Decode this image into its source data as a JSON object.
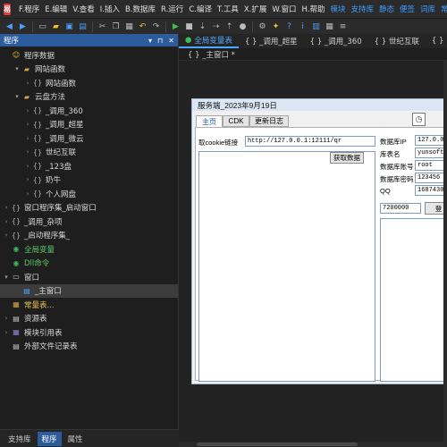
{
  "menu": {
    "items": [
      {
        "label": "F.程序",
        "accent": false
      },
      {
        "label": "E.编辑",
        "accent": false
      },
      {
        "label": "V.查看",
        "accent": false
      },
      {
        "label": "I.插入",
        "accent": false
      },
      {
        "label": "B.数据库",
        "accent": false
      },
      {
        "label": "R.运行",
        "accent": false
      },
      {
        "label": "C.编译",
        "accent": false
      },
      {
        "label": "T.工具",
        "accent": false
      },
      {
        "label": "X.扩展",
        "accent": false
      },
      {
        "label": "W.窗口",
        "accent": false
      },
      {
        "label": "H.帮助",
        "accent": false
      },
      {
        "label": "模块",
        "accent": true
      },
      {
        "label": "支持库",
        "accent": true
      },
      {
        "label": "静态",
        "accent": true
      },
      {
        "label": "便签",
        "accent": true
      },
      {
        "label": "词库",
        "accent": true
      },
      {
        "label": "常",
        "accent": true
      }
    ]
  },
  "toolbar": {
    "icons": [
      {
        "name": "back-icon",
        "glyph": "◀",
        "color": "blue"
      },
      {
        "name": "forward-icon",
        "glyph": "▶",
        "color": "blue"
      },
      {
        "name": "new-file-icon",
        "glyph": "▭",
        "color": ""
      },
      {
        "name": "open-folder-icon",
        "glyph": "▰",
        "color": "yellow"
      },
      {
        "name": "save-icon",
        "glyph": "▣",
        "color": "blue"
      },
      {
        "name": "save-all-icon",
        "glyph": "▤",
        "color": "blue"
      },
      {
        "name": "cut-icon",
        "glyph": "✂",
        "color": ""
      },
      {
        "name": "copy-icon",
        "glyph": "❐",
        "color": ""
      },
      {
        "name": "paste-icon",
        "glyph": "▦",
        "color": ""
      },
      {
        "name": "undo-icon",
        "glyph": "↶",
        "color": "yellow"
      },
      {
        "name": "redo-icon",
        "glyph": "↷",
        "color": ""
      },
      {
        "name": "run-icon",
        "glyph": "▶",
        "color": "green"
      },
      {
        "name": "stop-icon",
        "glyph": "■",
        "color": ""
      },
      {
        "name": "step-into-icon",
        "glyph": "⇣",
        "color": ""
      },
      {
        "name": "step-over-icon",
        "glyph": "⇢",
        "color": ""
      },
      {
        "name": "step-out-icon",
        "glyph": "⇡",
        "color": ""
      },
      {
        "name": "breakpoint-icon",
        "glyph": "●",
        "color": ""
      },
      {
        "name": "compile-icon",
        "glyph": "⚙",
        "color": ""
      },
      {
        "name": "lightbulb-icon",
        "glyph": "✦",
        "color": "yellow"
      },
      {
        "name": "help-icon",
        "glyph": "?",
        "color": "blue"
      },
      {
        "name": "info-icon",
        "glyph": "i",
        "color": "blue"
      },
      {
        "name": "chart-icon",
        "glyph": "▥",
        "color": "blue"
      },
      {
        "name": "grid-icon",
        "glyph": "▦",
        "color": ""
      },
      {
        "name": "list-icon",
        "glyph": "≡",
        "color": ""
      }
    ]
  },
  "left_panel": {
    "title": "程序",
    "controls": [
      "▾",
      "⊓",
      "✕"
    ],
    "tree": [
      {
        "label": "程序数据",
        "depth": 0,
        "arrow": "",
        "icon": "☺",
        "icon_name": "smile-icon",
        "icon_class": "smile",
        "style": "",
        "selected": false
      },
      {
        "label": "网站函数",
        "depth": 1,
        "arrow": "▾",
        "icon": "▰",
        "icon_name": "folder-icon",
        "icon_class": "folder",
        "style": "",
        "selected": false
      },
      {
        "label": "网站函数",
        "depth": 2,
        "arrow": "›",
        "icon": "{}",
        "icon_name": "code-module-icon",
        "icon_class": "code",
        "style": "",
        "selected": false
      },
      {
        "label": "云盘方法",
        "depth": 1,
        "arrow": "▾",
        "icon": "▰",
        "icon_name": "folder-icon",
        "icon_class": "folder",
        "style": "",
        "selected": false
      },
      {
        "label": "_调用_360",
        "depth": 2,
        "arrow": "›",
        "icon": "{}",
        "icon_name": "code-module-icon",
        "icon_class": "code",
        "style": "",
        "selected": false
      },
      {
        "label": "_调用_超星",
        "depth": 2,
        "arrow": "›",
        "icon": "{}",
        "icon_name": "code-module-icon",
        "icon_class": "code",
        "style": "",
        "selected": false
      },
      {
        "label": "_调用_微云",
        "depth": 2,
        "arrow": "›",
        "icon": "{}",
        "icon_name": "code-module-icon",
        "icon_class": "code",
        "style": "",
        "selected": false
      },
      {
        "label": "世纪互联",
        "depth": 2,
        "arrow": "›",
        "icon": "{}",
        "icon_name": "code-module-icon",
        "icon_class": "code",
        "style": "",
        "selected": false
      },
      {
        "label": "_123盘",
        "depth": 2,
        "arrow": "›",
        "icon": "{}",
        "icon_name": "code-module-icon",
        "icon_class": "code",
        "style": "",
        "selected": false
      },
      {
        "label": "奶牛",
        "depth": 2,
        "arrow": "›",
        "icon": "{}",
        "icon_name": "code-module-icon",
        "icon_class": "code",
        "style": "",
        "selected": false
      },
      {
        "label": "个人网盘",
        "depth": 2,
        "arrow": "›",
        "icon": "{}",
        "icon_name": "code-module-icon",
        "icon_class": "code",
        "style": "",
        "selected": false
      },
      {
        "label": "窗口程序集_启动窗口",
        "depth": 0,
        "arrow": "›",
        "icon": "{}",
        "icon_name": "code-module-icon",
        "icon_class": "code",
        "style": "",
        "selected": false
      },
      {
        "label": "_调用_杂项",
        "depth": 0,
        "arrow": "›",
        "icon": "{}",
        "icon_name": "code-module-icon",
        "icon_class": "code",
        "style": "",
        "selected": false
      },
      {
        "label": "_启动程序集_",
        "depth": 0,
        "arrow": "›",
        "icon": "{}",
        "icon_name": "code-module-icon",
        "icon_class": "code",
        "style": "",
        "selected": false
      },
      {
        "label": "全局变量",
        "depth": 0,
        "arrow": "",
        "icon": "◉",
        "icon_name": "global-variable-icon",
        "icon_class": "green",
        "style": "greentext",
        "selected": false
      },
      {
        "label": "Dll命令",
        "depth": 0,
        "arrow": "",
        "icon": "◉",
        "icon_name": "dll-command-icon",
        "icon_class": "green",
        "style": "greentext",
        "selected": false
      },
      {
        "label": "窗口",
        "depth": 0,
        "arrow": "▾",
        "icon": "▭",
        "icon_name": "window-icon",
        "icon_class": "win",
        "style": "",
        "selected": false
      },
      {
        "label": "_主窗口",
        "depth": 1,
        "arrow": "",
        "icon": "▤",
        "icon_name": "form-icon",
        "icon_class": "db",
        "style": "",
        "selected": true
      },
      {
        "label": "常量表...",
        "depth": 0,
        "arrow": "",
        "icon": "▦",
        "icon_name": "constant-table-icon",
        "icon_class": "folder",
        "style": "yellowtext",
        "selected": false
      },
      {
        "label": "资源表",
        "depth": 0,
        "arrow": "›",
        "icon": "▤",
        "icon_name": "resource-table-icon",
        "icon_class": "win",
        "style": "",
        "selected": false
      },
      {
        "label": "模块引用表",
        "depth": 0,
        "arrow": "›",
        "icon": "▦",
        "icon_name": "module-reference-icon",
        "icon_class": "grid",
        "style": "",
        "selected": false
      },
      {
        "label": "外部文件记录表",
        "depth": 0,
        "arrow": "",
        "icon": "▤",
        "icon_name": "external-file-icon",
        "icon_class": "win",
        "style": "",
        "selected": false
      }
    ]
  },
  "bottom_tabs": [
    {
      "label": "支持库",
      "active": false
    },
    {
      "label": "程序",
      "active": true
    },
    {
      "label": "属性",
      "active": false
    }
  ],
  "editor": {
    "tabs": [
      {
        "label": "全局变量表",
        "active": true,
        "dot": "●"
      },
      {
        "label": "{ } _调用_超星",
        "active": false,
        "dot": ""
      },
      {
        "label": "{ } _调用_360",
        "active": false,
        "dot": ""
      },
      {
        "label": "{ } 世纪互联",
        "active": false,
        "dot": ""
      },
      {
        "label": "{ }",
        "active": false,
        "dot": ""
      }
    ],
    "sub_tab": "{ } _主窗口 *"
  },
  "form": {
    "title": "服务端_2023年9月19日",
    "tabs": [
      "主页",
      "CDK",
      "更新日志"
    ],
    "cookie_label": "取cookie链接",
    "cookie_url": "http://127.0.0.1:12111/qr",
    "fetch_button": "获取数据",
    "db_ip_label": "数据库IP",
    "db_ip_value": "127.0.0.1",
    "db_name_label": "库表名",
    "db_name_value": "yunsoft1",
    "db_user_label": "数据库账号",
    "db_user_value": "root",
    "db_pass_label": "数据库密码",
    "db_pass_value": "123456",
    "qq_label": "QQ",
    "qq_value": "1687430",
    "number_value": "7200000",
    "small_button": "登"
  }
}
